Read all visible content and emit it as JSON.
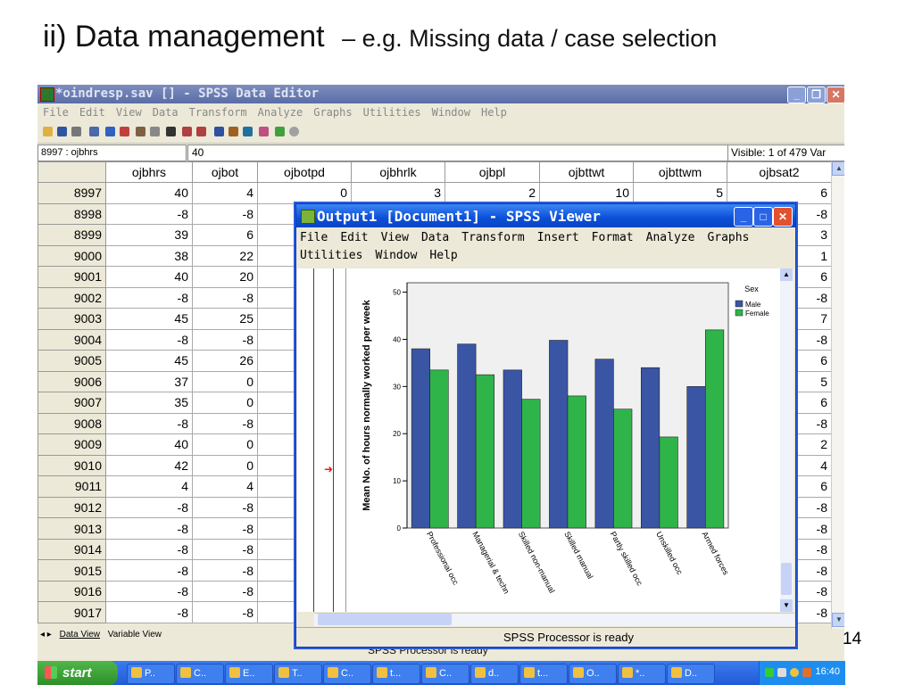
{
  "slide": {
    "title": "ii) Data management",
    "subtitle": "– e.g. Missing data / case selection",
    "page_number": "14"
  },
  "editor": {
    "title": "*oindresp.sav [] - SPSS Data Editor",
    "menu": [
      "File",
      "Edit",
      "View",
      "Data",
      "Transform",
      "Analyze",
      "Graphs",
      "Utilities",
      "Window",
      "Help"
    ],
    "cell_ref": "8997 : ojbhrs",
    "cell_value": "40",
    "visible": "Visible: 1 of 479 Var",
    "columns": [
      "ojbhrs",
      "ojbot",
      "ojbotpd",
      "ojbhrlk",
      "ojbpl",
      "ojbttwt",
      "ojbttwm",
      "ojbsat2"
    ],
    "rows": [
      {
        "id": "8997",
        "ojbhrs": "40",
        "ojbot": "4",
        "ojbotpd": "0",
        "ojbhrlk": "3",
        "ojbpl": "2",
        "ojbttwt": "10",
        "ojbttwm": "5",
        "ojbsat2": "6"
      },
      {
        "id": "8998",
        "ojbhrs": "-8",
        "ojbot": "-8",
        "ojbsat2": "-8"
      },
      {
        "id": "8999",
        "ojbhrs": "39",
        "ojbot": "6",
        "ojbsat2": "3"
      },
      {
        "id": "9000",
        "ojbhrs": "38",
        "ojbot": "22",
        "ojbsat2": "1"
      },
      {
        "id": "9001",
        "ojbhrs": "40",
        "ojbot": "20",
        "ojbsat2": "6"
      },
      {
        "id": "9002",
        "ojbhrs": "-8",
        "ojbot": "-8",
        "ojbsat2": "-8"
      },
      {
        "id": "9003",
        "ojbhrs": "45",
        "ojbot": "25",
        "ojbsat2": "7"
      },
      {
        "id": "9004",
        "ojbhrs": "-8",
        "ojbot": "-8",
        "ojbsat2": "-8"
      },
      {
        "id": "9005",
        "ojbhrs": "45",
        "ojbot": "26",
        "ojbsat2": "6"
      },
      {
        "id": "9006",
        "ojbhrs": "37",
        "ojbot": "0",
        "ojbsat2": "5"
      },
      {
        "id": "9007",
        "ojbhrs": "35",
        "ojbot": "0",
        "ojbsat2": "6"
      },
      {
        "id": "9008",
        "ojbhrs": "-8",
        "ojbot": "-8",
        "ojbsat2": "-8"
      },
      {
        "id": "9009",
        "ojbhrs": "40",
        "ojbot": "0",
        "ojbsat2": "2"
      },
      {
        "id": "9010",
        "ojbhrs": "42",
        "ojbot": "0",
        "ojbsat2": "4"
      },
      {
        "id": "9011",
        "ojbhrs": "4",
        "ojbot": "4",
        "ojbsat2": "6"
      },
      {
        "id": "9012",
        "ojbhrs": "-8",
        "ojbot": "-8",
        "ojbsat2": "-8"
      },
      {
        "id": "9013",
        "ojbhrs": "-8",
        "ojbot": "-8",
        "ojbsat2": "-8"
      },
      {
        "id": "9014",
        "ojbhrs": "-8",
        "ojbot": "-8",
        "ojbsat2": "-8"
      },
      {
        "id": "9015",
        "ojbhrs": "-8",
        "ojbot": "-8",
        "ojbsat2": "-8"
      },
      {
        "id": "9016",
        "ojbhrs": "-8",
        "ojbot": "-8",
        "ojbsat2": "-8"
      },
      {
        "id": "9017",
        "ojbhrs": "-8",
        "ojbot": "-8",
        "ojbsat2": "-8"
      }
    ],
    "tabs": {
      "data_view": "Data View",
      "variable_view": "Variable View"
    },
    "status": "SPSS Processor is ready"
  },
  "viewer": {
    "title": "Output1 [Document1] - SPSS Viewer",
    "menu_row1": [
      "File",
      "Edit",
      "View",
      "Data",
      "Transform",
      "Insert",
      "Format",
      "Analyze",
      "Graphs"
    ],
    "menu_row2": [
      "Utilities",
      "Window",
      "Help"
    ],
    "status": "SPSS Processor is ready"
  },
  "chart_data": {
    "type": "bar",
    "categories": [
      "Professional occ",
      "Managerial & techn",
      "Skilled non-manual",
      "Skilled manual",
      "Partly skilled occ",
      "Unskilled occ",
      "Armed forces"
    ],
    "series": [
      {
        "name": "Male",
        "color": "#3a55a4",
        "values": [
          38,
          39,
          33.5,
          39.8,
          35.8,
          34,
          30
        ]
      },
      {
        "name": "Female",
        "color": "#2fb44a",
        "values": [
          33.5,
          32.5,
          27.3,
          28,
          25.2,
          19.3,
          42
        ]
      }
    ],
    "ylabel": "Mean No. of hours normally worked per week",
    "legend_title": "Sex",
    "ylim": [
      0,
      52
    ],
    "yticks": [
      0,
      10,
      20,
      30,
      40,
      50
    ],
    "legend_position": "top-right",
    "grid": false
  },
  "taskbar": {
    "start": "start",
    "items": [
      "P..",
      "C..",
      "E..",
      "T..",
      "C..",
      "t...",
      "C..",
      "d..",
      "t...",
      "O..",
      "*..",
      "D.."
    ],
    "clock": "16:40"
  }
}
